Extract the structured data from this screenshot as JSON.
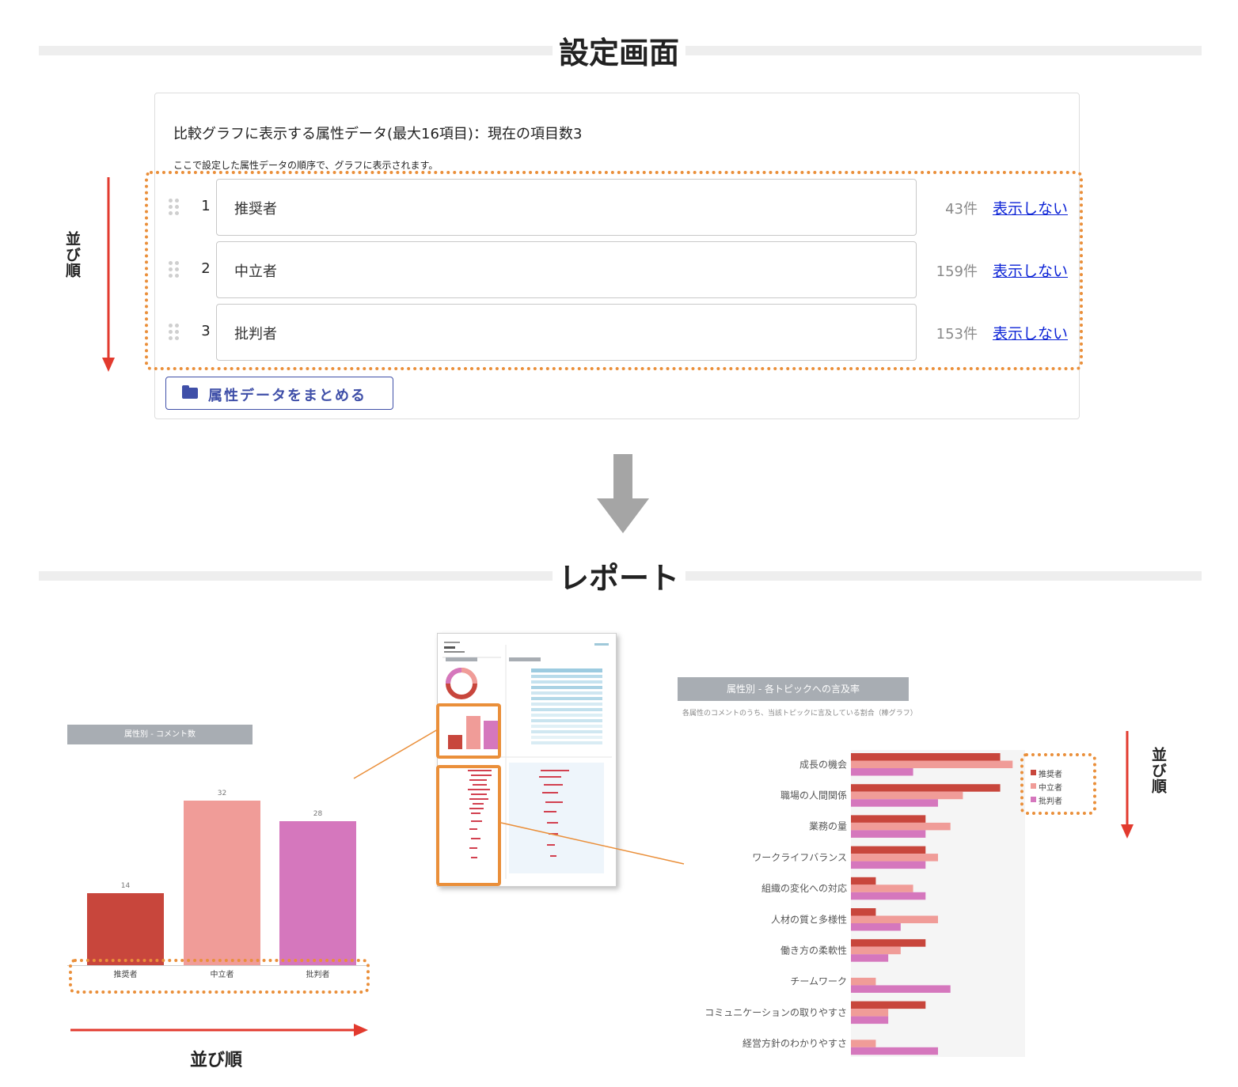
{
  "settings": {
    "title": "設定画面",
    "card_title": "比較グラフに表示する属性データ(最大16項目)：現在の項目数3",
    "card_sub": "ここで設定した属性データの順序で、グラフに表示されます。",
    "rows": [
      {
        "num": "1",
        "label": "推奨者",
        "count": "43件",
        "link": "表示しない"
      },
      {
        "num": "2",
        "label": "中立者",
        "count": "159件",
        "link": "表示しない"
      },
      {
        "num": "3",
        "label": "批判者",
        "count": "153件",
        "link": "表示しない"
      }
    ],
    "merge_button": "属性データをまとめる",
    "order_label": "並び順"
  },
  "report": {
    "title": "レポート",
    "order_label_bottom": "並び順",
    "order_label_right": "並び順"
  },
  "colors": {
    "promoter": "#c8463c",
    "neutral": "#f09c98",
    "detractor": "#d577bd",
    "highlight": "#ea8f3a",
    "arrow_red": "#e23a2e",
    "link": "#0b22d6",
    "button": "#3f4fa8"
  },
  "chart_data": [
    {
      "type": "bar",
      "title": "属性別 - コメント数",
      "categories": [
        "推奨者",
        "中立者",
        "批判者"
      ],
      "values": [
        14,
        32,
        28
      ],
      "ylim": [
        0,
        36
      ]
    },
    {
      "type": "bar",
      "orientation": "horizontal",
      "title": "属性別 - 各トピックへの言及率",
      "subtitle": "各属性のコメントのうち、当該トピックに言及している割合（棒グラフ）",
      "categories": [
        "成長の機会",
        "職場の人間関係",
        "業務の量",
        "ワークライフバランス",
        "組織の変化への対応",
        "人材の質と多様性",
        "働き方の柔軟性",
        "チームワーク",
        "コミュニケーションの取りやすさ",
        "経営方針のわかりやすさ"
      ],
      "series": [
        {
          "name": "推奨者",
          "values": [
            12,
            12,
            6,
            6,
            2,
            2,
            6,
            0,
            6,
            0
          ]
        },
        {
          "name": "中立者",
          "values": [
            13,
            9,
            8,
            7,
            5,
            7,
            4,
            2,
            3,
            2
          ]
        },
        {
          "name": "批判者",
          "values": [
            5,
            7,
            6,
            6,
            6,
            4,
            3,
            8,
            3,
            7
          ]
        }
      ],
      "xlim": [
        0,
        14
      ],
      "legend": "top-right"
    }
  ]
}
